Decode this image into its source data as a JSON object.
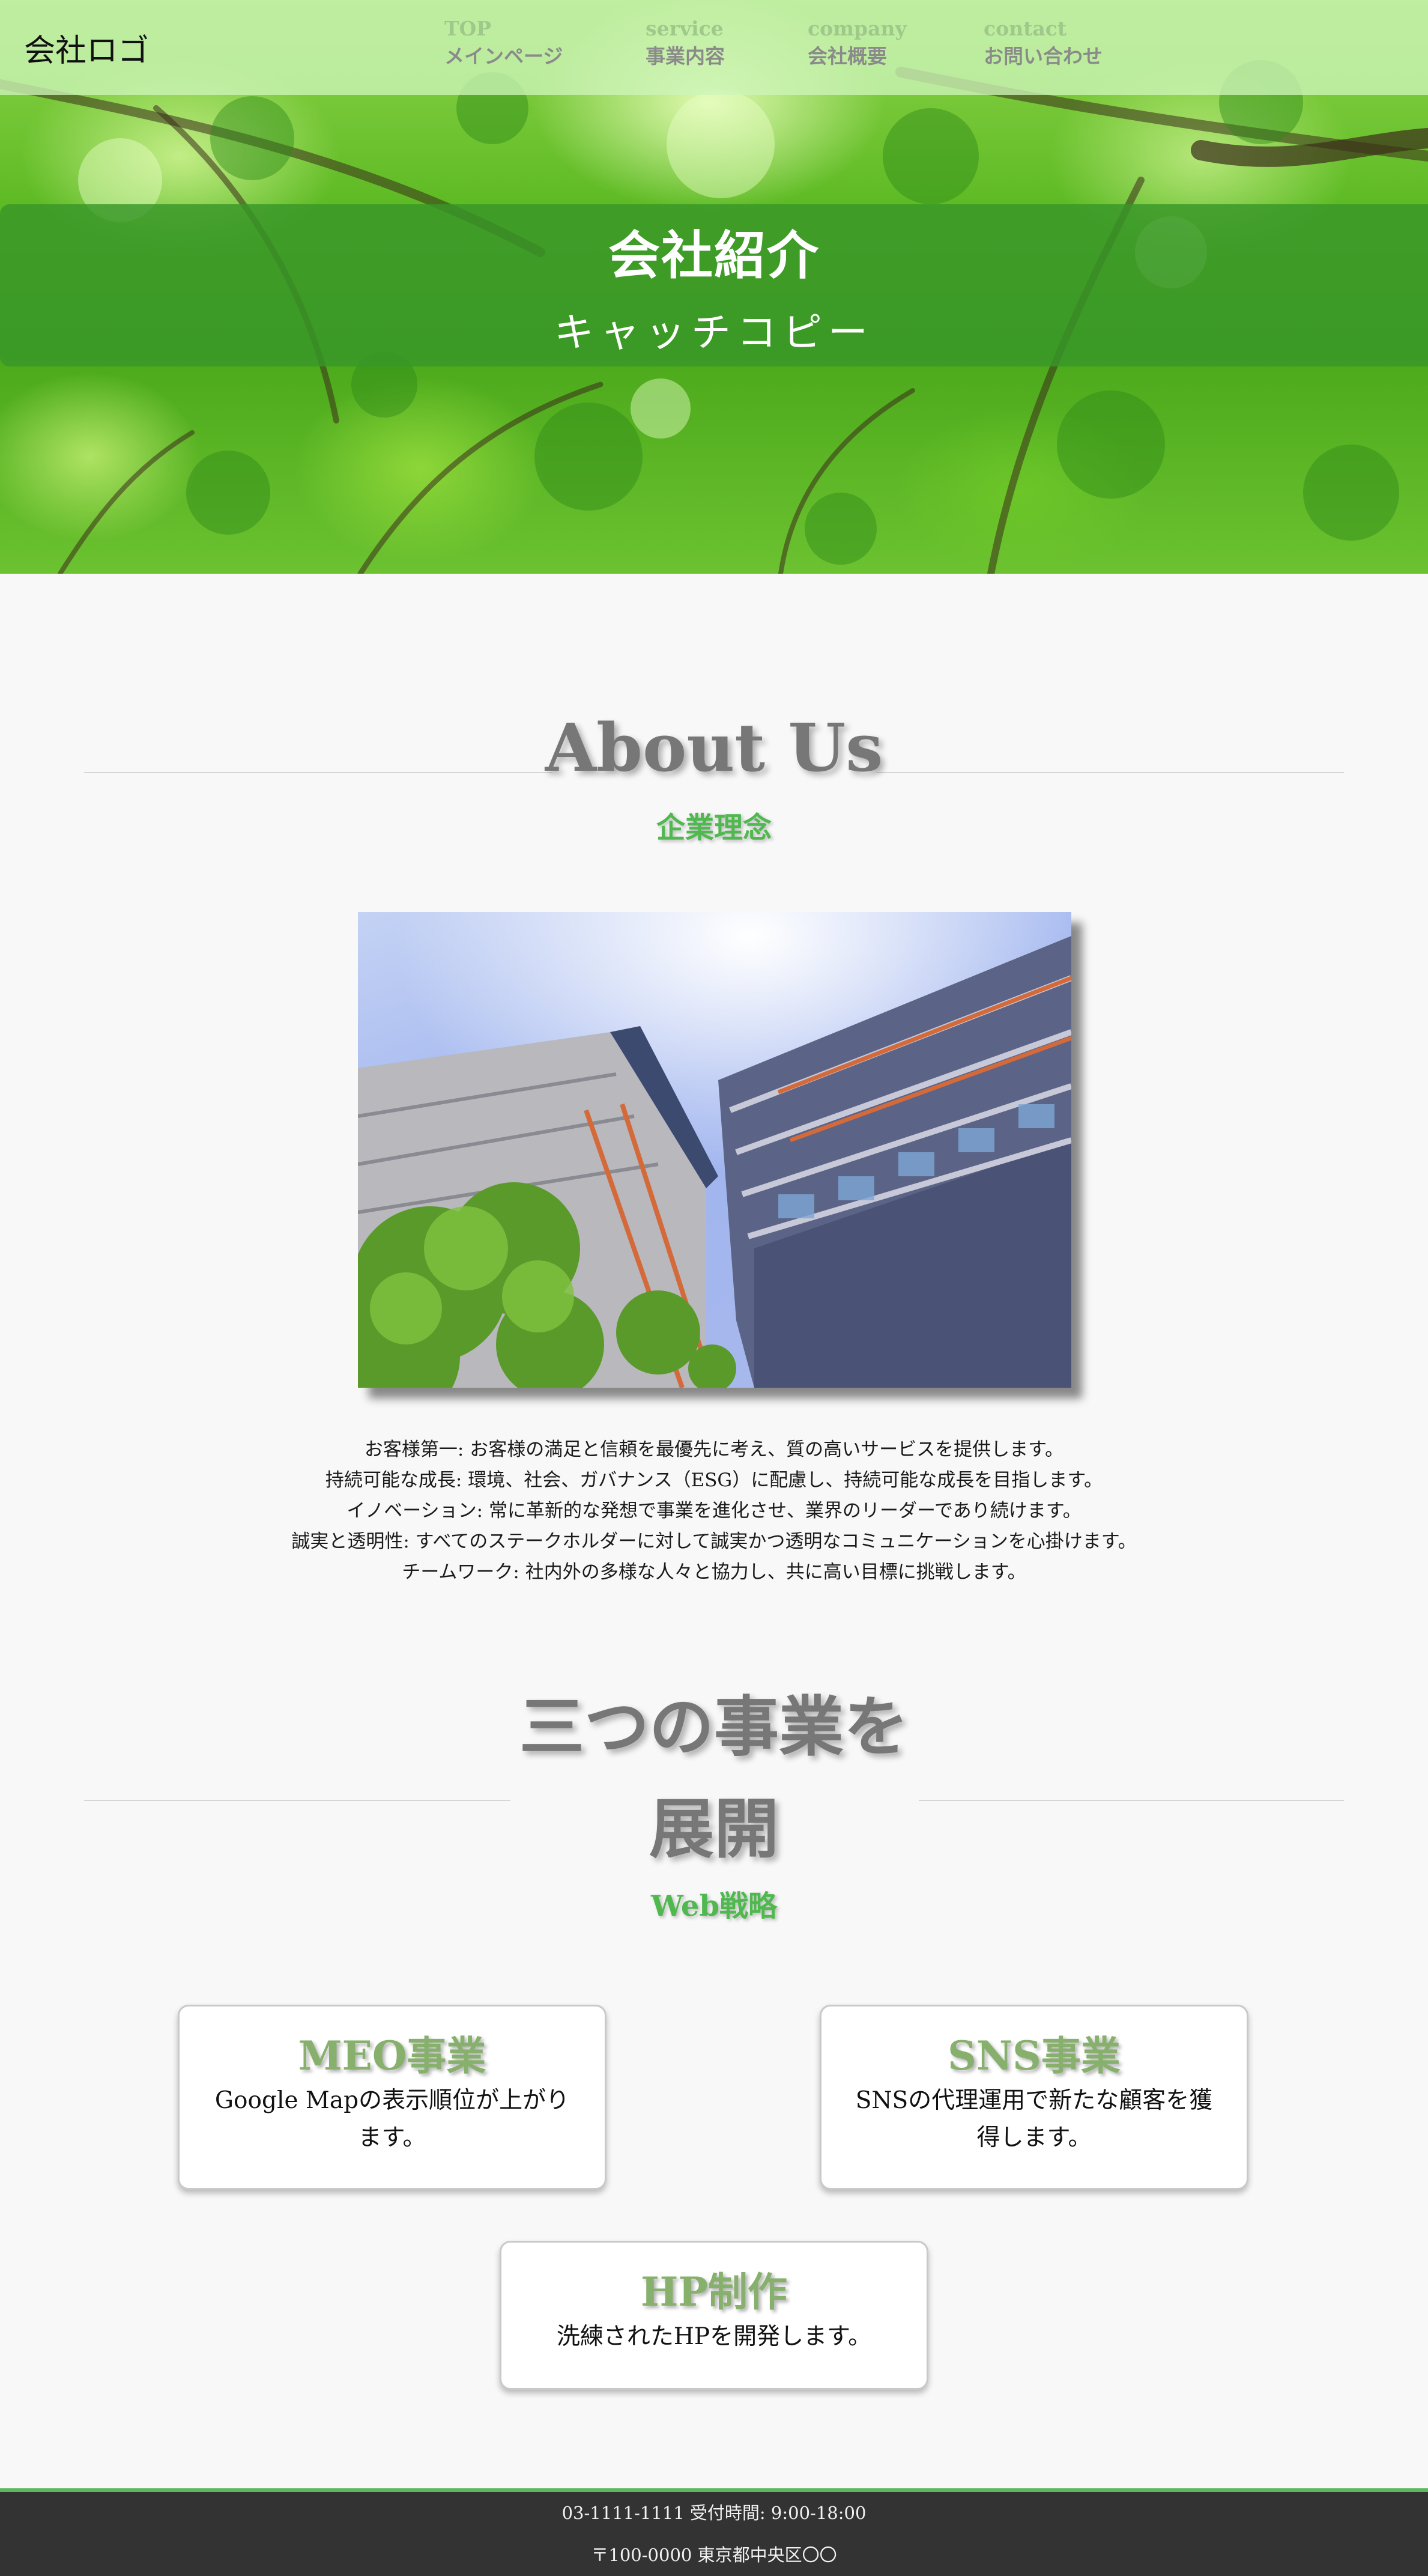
{
  "header": {
    "logo": "会社ロゴ",
    "nav": [
      {
        "en": "TOP",
        "jp": "メインページ"
      },
      {
        "en": "service",
        "jp": "事業内容"
      },
      {
        "en": "company",
        "jp": "会社概要"
      },
      {
        "en": "contact",
        "jp": "お問い合わせ"
      }
    ]
  },
  "hero": {
    "title": "会社紹介",
    "catchcopy": "キャッチコピー"
  },
  "about": {
    "title": "About Us",
    "subtitle": "企業理念",
    "philosophy": [
      "お客様第一: お客様の満足と信頼を最優先に考え、質の高いサービスを提供します。",
      "持続可能な成長: 環境、社会、ガバナンス（ESG）に配慮し、持続可能な成長を目指します。",
      "イノベーション: 常に革新的な発想で事業を進化させ、業界のリーダーであり続けます。",
      "誠実と透明性: すべてのステークホルダーに対して誠実かつ透明なコミュニケーションを心掛けます。",
      "チームワーク: 社内外の多様な人々と協力し、共に高い目標に挑戦します。"
    ]
  },
  "business": {
    "title_line1": "三つの事業を",
    "title_line2": "展開",
    "subtitle": "Web戦略",
    "cards": [
      {
        "title": "MEO事業",
        "desc": "Google Mapの表示順位が上がります。"
      },
      {
        "title": "SNS事業",
        "desc": "SNSの代理運用で新たな顧客を獲得します。"
      },
      {
        "title": "HP制作",
        "desc": "洗練されたHPを開発します。"
      }
    ]
  },
  "footer": {
    "phone": "03-1111-1111 受付時間: 9:00-18:00",
    "address": "〒100-0000 東京都中央区〇〇"
  },
  "colors": {
    "nav_bar": "#cdf5b9",
    "hero_band": "#389628",
    "accent_green": "#4fb84f",
    "card_title": "#86b06c",
    "heading_gray": "#777777",
    "footer_bg": "#333333",
    "footer_border": "#5cb85c"
  }
}
